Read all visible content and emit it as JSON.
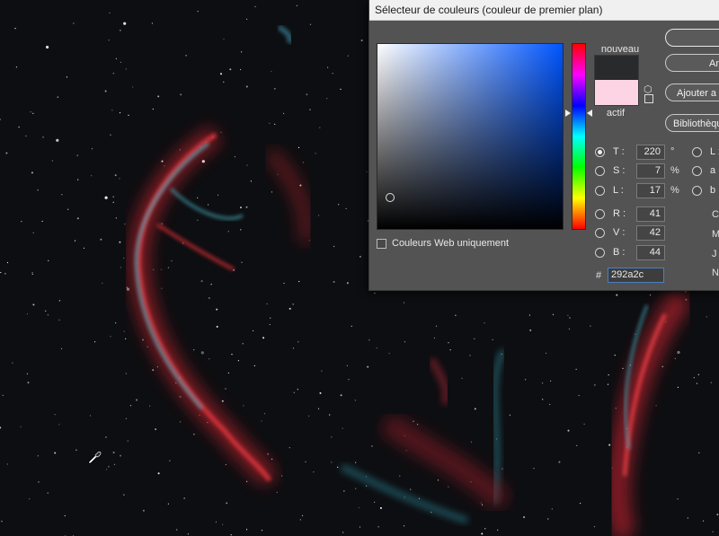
{
  "dialog": {
    "title": "Sélecteur de couleurs (couleur de premier plan)",
    "label_new": "nouveau",
    "label_current": "actif",
    "new_color": "#292a2c",
    "current_color": "#fcd4e4",
    "web_only_label": "Couleurs Web uniquement",
    "buttons": {
      "ok": "",
      "cancel": "An",
      "add": "Ajouter a",
      "libraries": "Bibliothèqu"
    },
    "hsb": [
      {
        "label": "T :",
        "value": "220",
        "unit": "°",
        "selected": true
      },
      {
        "label": "S :",
        "value": "7",
        "unit": "%",
        "selected": false
      },
      {
        "label": "L :",
        "value": "17",
        "unit": "%",
        "selected": false
      }
    ],
    "rgb": [
      {
        "label": "R :",
        "value": "41"
      },
      {
        "label": "V :",
        "value": "42"
      },
      {
        "label": "B :",
        "value": "44"
      }
    ],
    "lab": [
      {
        "label": "L :"
      },
      {
        "label": "a :"
      },
      {
        "label": "b :"
      }
    ],
    "cmyk": [
      "C",
      "M",
      "J",
      "N"
    ],
    "hex_label": "#",
    "hex_value": "292a2c"
  },
  "annotation": {
    "color": "#ea6a1e"
  }
}
